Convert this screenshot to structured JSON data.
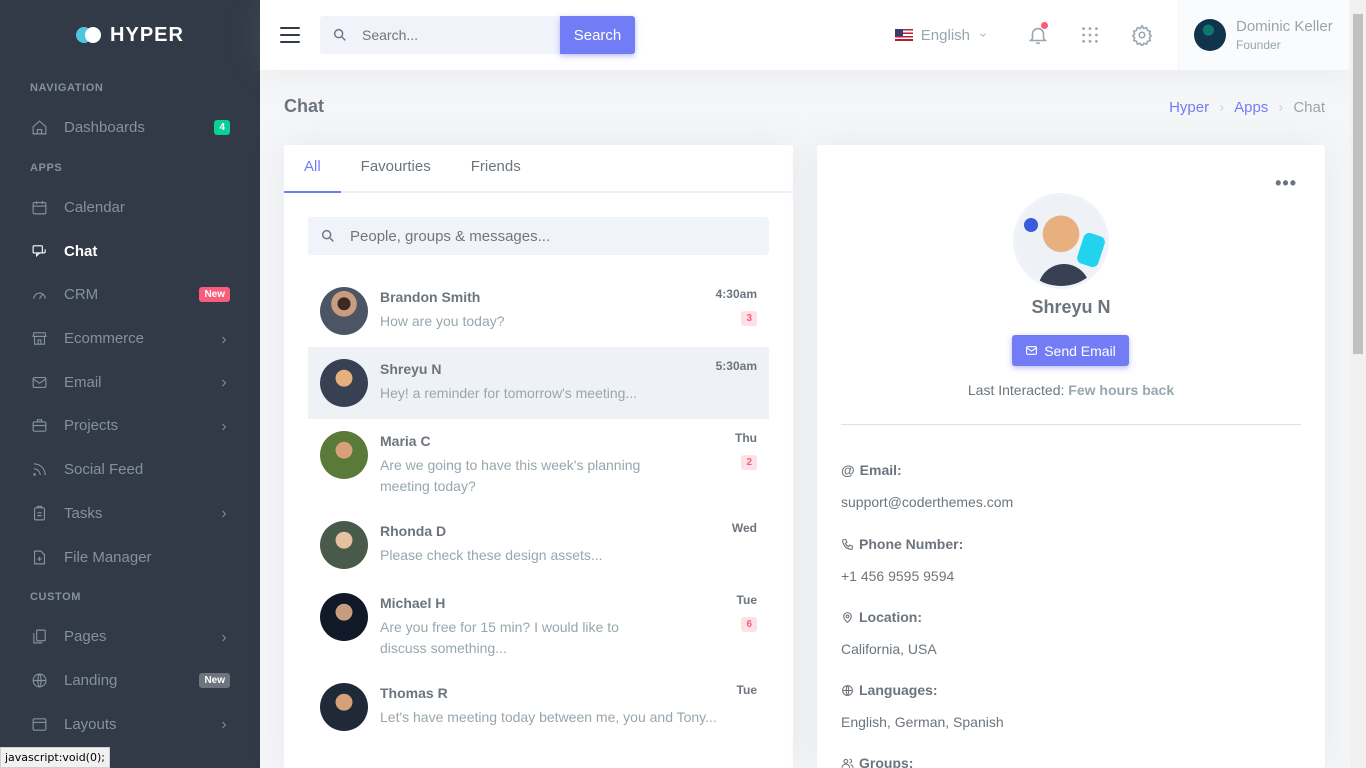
{
  "brand": {
    "name": "HYPER"
  },
  "sidebar": {
    "sections": [
      {
        "title": "Navigation"
      },
      {
        "title": "Apps"
      },
      {
        "title": "Custom"
      }
    ],
    "items": [
      {
        "label": "Dashboards",
        "icon": "home-icon",
        "badge": "4"
      },
      {
        "label": "Calendar",
        "icon": "calendar-icon"
      },
      {
        "label": "Chat",
        "icon": "chat-icon"
      },
      {
        "label": "CRM",
        "icon": "gauge-icon",
        "badge": "New"
      },
      {
        "label": "Ecommerce",
        "icon": "store-icon"
      },
      {
        "label": "Email",
        "icon": "mail-icon"
      },
      {
        "label": "Projects",
        "icon": "briefcase-icon"
      },
      {
        "label": "Social Feed",
        "icon": "rss-icon"
      },
      {
        "label": "Tasks",
        "icon": "clipboard-icon"
      },
      {
        "label": "File Manager",
        "icon": "folder-icon"
      },
      {
        "label": "Pages",
        "icon": "copy-icon"
      },
      {
        "label": "Landing",
        "icon": "globe-icon",
        "badge": "New"
      },
      {
        "label": "Layouts",
        "icon": "window-icon"
      }
    ]
  },
  "topbar": {
    "search_placeholder": "Search...",
    "search_button": "Search",
    "language": "English",
    "user": {
      "name": "Dominic Keller",
      "role": "Founder"
    }
  },
  "page": {
    "title": "Chat",
    "breadcrumb": [
      "Hyper",
      "Apps",
      "Chat"
    ]
  },
  "chat": {
    "tabs": [
      "All",
      "Favourties",
      "Friends"
    ],
    "search_placeholder": "People, groups & messages...",
    "conversations": [
      {
        "name": "Brandon Smith",
        "time": "4:30am",
        "message": "How are you today?",
        "unread": "3"
      },
      {
        "name": "Shreyu N",
        "time": "5:30am",
        "message": "Hey! a reminder for tomorrow's meeting..."
      },
      {
        "name": "Maria C",
        "time": "Thu",
        "message": "Are we going to have this week's planning meeting today?",
        "unread": "2"
      },
      {
        "name": "Rhonda D",
        "time": "Wed",
        "message": "Please check these design assets..."
      },
      {
        "name": "Michael H",
        "time": "Tue",
        "message": "Are you free for 15 min? I would like to discuss something...",
        "unread": "6"
      },
      {
        "name": "Thomas R",
        "time": "Tue",
        "message": "Let's have meeting today between me, you and Tony..."
      }
    ]
  },
  "profile": {
    "name": "Shreyu N",
    "send_email": "Send Email",
    "last_interacted_label": "Last Interacted:",
    "last_interacted_value": "Few hours back",
    "email_label": "Email:",
    "email": "support@coderthemes.com",
    "phone_label": "Phone Number:",
    "phone": "+1 456 9595 9594",
    "location_label": "Location:",
    "location": "California, USA",
    "languages_label": "Languages:",
    "languages": "English, German, Spanish",
    "groups_label": "Groups:"
  },
  "statusbar": {
    "text": "javascript:void(0);"
  },
  "colors": {
    "primary": "#727cf5",
    "sidebar": "#313a46",
    "success": "#0acf97",
    "danger": "#fa5c7c"
  }
}
